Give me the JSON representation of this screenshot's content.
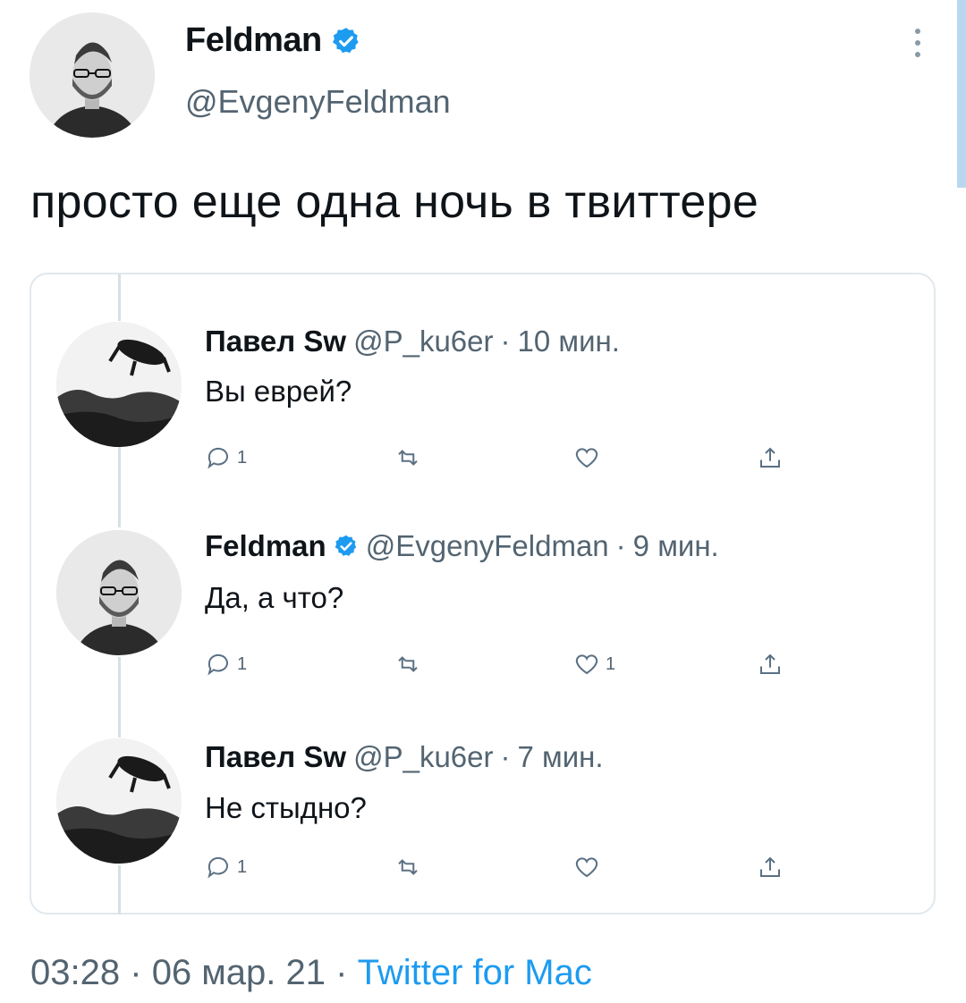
{
  "tweet": {
    "author": {
      "name": "Feldman",
      "handle": "@EvgenyFeldman",
      "verified": true
    },
    "text": "просто еще одна ночь в твиттере",
    "timestamp": {
      "time": "03:28",
      "separator": "·",
      "date": "06 мар. 21",
      "separator2": "·",
      "source": "Twitter for Mac"
    }
  },
  "replies": [
    {
      "name": "Павел Sw",
      "handle": "@P_ku6er",
      "separator": "·",
      "time": "10 мин.",
      "verified": false,
      "text": "Вы еврей?",
      "reply_count": "1",
      "retweet_count": "",
      "like_count": ""
    },
    {
      "name": "Feldman",
      "handle": "@EvgenyFeldman",
      "separator": "·",
      "time": "9 мин.",
      "verified": true,
      "text": "Да, а что?",
      "reply_count": "1",
      "retweet_count": "",
      "like_count": "1"
    },
    {
      "name": "Павел Sw",
      "handle": "@P_ku6er",
      "separator": "·",
      "time": "7 мин.",
      "verified": false,
      "text": "Не стыдно?",
      "reply_count": "1",
      "retweet_count": "",
      "like_count": ""
    }
  ],
  "icons": {
    "reply": "reply-icon",
    "retweet": "retweet-icon",
    "like": "heart-icon",
    "share": "share-icon",
    "verified": "verified-badge-icon",
    "more": "more-icon"
  },
  "colors": {
    "accent": "#1d9bf0",
    "secondary_text": "#536471",
    "border": "#e1e8ed"
  }
}
